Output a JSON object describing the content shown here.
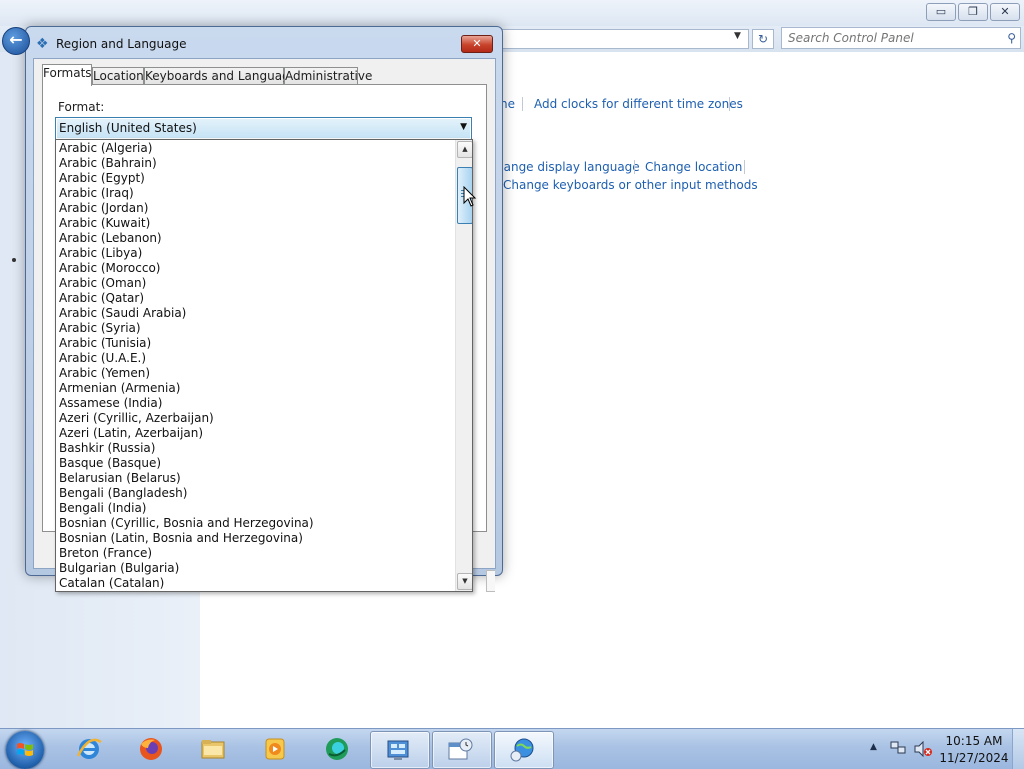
{
  "control_panel": {
    "search_placeholder": "Search Control Panel",
    "links": {
      "set_time_partial": "ne",
      "add_clocks": "Add clocks for different time zones",
      "change_display_language_partial": "hange display language",
      "change_location": "Change location",
      "change_keyboards": "Change keyboards or other input methods"
    },
    "caption_buttons": {
      "minimize": "▭",
      "maximize": "❐",
      "close": "✕"
    }
  },
  "dialog": {
    "title": "Region and Language",
    "close_label": "✕",
    "tabs": [
      {
        "label": "Formats",
        "active": true
      },
      {
        "label": "Location",
        "active": false
      },
      {
        "label": "Keyboards and Languages",
        "active": false
      },
      {
        "label": "Administrative",
        "active": false
      }
    ],
    "format_label": "Format:",
    "format_selected": "English (United States)",
    "format_options": [
      "Arabic (Algeria)",
      "Arabic (Bahrain)",
      "Arabic (Egypt)",
      "Arabic (Iraq)",
      "Arabic (Jordan)",
      "Arabic (Kuwait)",
      "Arabic (Lebanon)",
      "Arabic (Libya)",
      "Arabic (Morocco)",
      "Arabic (Oman)",
      "Arabic (Qatar)",
      "Arabic (Saudi Arabia)",
      "Arabic (Syria)",
      "Arabic (Tunisia)",
      "Arabic (U.A.E.)",
      "Arabic (Yemen)",
      "Armenian (Armenia)",
      "Assamese (India)",
      "Azeri (Cyrillic, Azerbaijan)",
      "Azeri (Latin, Azerbaijan)",
      "Bashkir (Russia)",
      "Basque (Basque)",
      "Belarusian (Belarus)",
      "Bengali (Bangladesh)",
      "Bengali (India)",
      "Bosnian (Cyrillic, Bosnia and Herzegovina)",
      "Bosnian (Latin, Bosnia and Herzegovina)",
      "Breton (France)",
      "Bulgarian (Bulgaria)",
      "Catalan (Catalan)"
    ]
  },
  "taskbar": {
    "pinned": [
      "internet-explorer",
      "firefox",
      "file-explorer",
      "media-player",
      "app-green"
    ],
    "tasks": [
      "control-panel",
      "calculator-clock",
      "region-language"
    ],
    "clock_time": "10:15 AM",
    "clock_date": "11/27/2024"
  },
  "colors": {
    "link": "#1e5fb0",
    "taskbar": "#a9c2e4",
    "dialog_frame": "#b5c8e2",
    "close_red": "#c8432b"
  }
}
